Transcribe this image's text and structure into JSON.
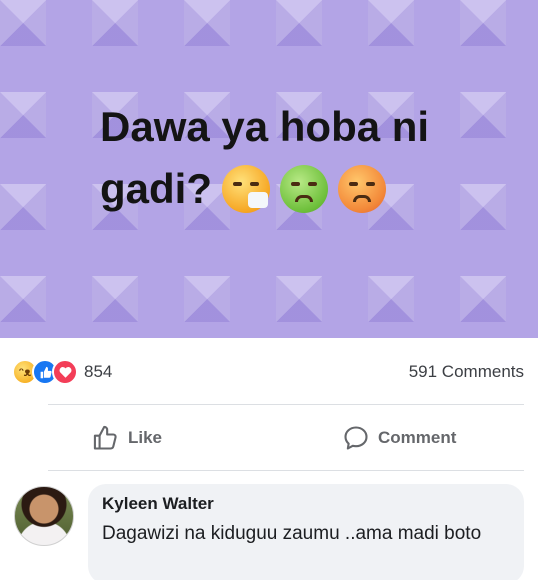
{
  "post": {
    "text_line1": "Dawa ya hoba ni",
    "text_line2": "gadi?",
    "emojis": [
      "sneezing-face-emoji",
      "nauseated-face-emoji",
      "woozy-face-emoji"
    ],
    "background_color": "#b3a4e6"
  },
  "reactions": {
    "icons": [
      "haha",
      "like",
      "love"
    ],
    "count": "854",
    "comments_count": "591 Comments"
  },
  "actions": {
    "like_label": "Like",
    "comment_label": "Comment"
  },
  "comment": {
    "author": "Kyleen Walter",
    "text": "Dagawizi na kiduguu zaumu ..ama madi boto"
  },
  "colors": {
    "accent_like": "#1877f2",
    "accent_love": "#f33e58",
    "muted_text": "#65676b",
    "bubble": "#f0f2f5"
  }
}
